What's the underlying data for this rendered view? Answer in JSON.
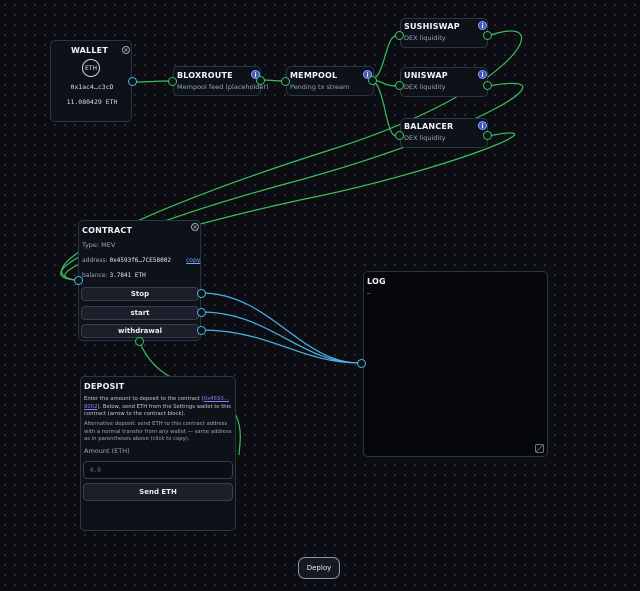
{
  "colors": {
    "wire_green": "#3cbf5a",
    "wire_blue": "#4db3e6",
    "info_blue": "#3f57b8",
    "link_purple": "#8a7cff"
  },
  "wallet": {
    "title": "WALLET",
    "avatar": "ETH",
    "address": "0x1ac4…c3cD",
    "balance": "11.080429 ETH"
  },
  "bloxroute": {
    "title": "BLOXROUTE",
    "sub": "Mempool feed (placeholder)",
    "info": "i"
  },
  "mempool": {
    "title": "MEMPOOL",
    "sub": "Pending tx stream",
    "info": "i"
  },
  "sushiswap": {
    "title": "SUSHISWAP",
    "sub": "DEX liquidity",
    "info": "i"
  },
  "uniswap": {
    "title": "UNISWAP",
    "sub": "DEX liquidity",
    "info": "i"
  },
  "balancer": {
    "title": "BALANCER",
    "sub": "DEX liquidity",
    "info": "i"
  },
  "contract": {
    "title": "CONTRACT",
    "type_label": "Type: MEV",
    "address_label": "address:",
    "address": "0x4593f6…7CE58002",
    "copy": "copy",
    "balance_label": "balance:",
    "balance": "3.7841 ETH",
    "buttons": {
      "stop": "Stop",
      "start": "start",
      "withdrawal": "withdrawal"
    }
  },
  "log": {
    "title": "LOG",
    "content": "–"
  },
  "deposit": {
    "title": "DEPOSIT",
    "text1_a": "Enter the amount to deposit to the contract (",
    "text1_link": "0x4593…8002",
    "text1_b": "). Below, send ETH from the Settings wallet to this contract (arrow to the contract block).",
    "text2": "Alternative deposit: send ETH to this contract address with a normal transfer from any wallet — same address as in parentheses above (click to copy).",
    "amount_label": "Amount (ETH)",
    "amount_placeholder": "0.0",
    "send_label": "Send ETH"
  },
  "deploy": {
    "label": "Deploy"
  },
  "close_glyph": "×"
}
